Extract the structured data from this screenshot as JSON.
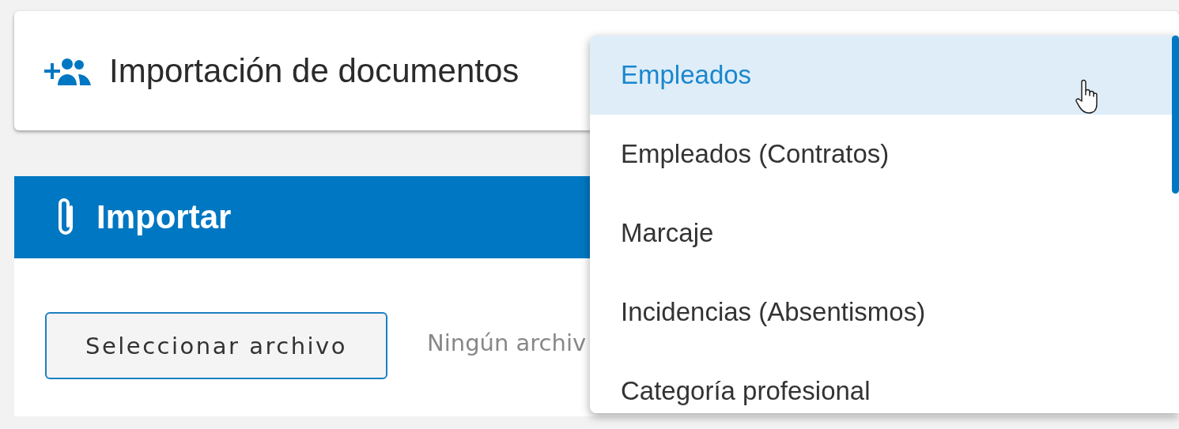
{
  "header": {
    "title": "Importación de documentos"
  },
  "import_panel": {
    "title": "Importar",
    "file_button": "Seleccionar archivo",
    "file_status": "Ningún archiv"
  },
  "dropdown": {
    "items": [
      {
        "label": "Empleados",
        "selected": true
      },
      {
        "label": "Empleados (Contratos)",
        "selected": false
      },
      {
        "label": "Marcaje",
        "selected": false
      },
      {
        "label": "Incidencias (Absentismos)",
        "selected": false
      },
      {
        "label": "Categoría profesional",
        "selected": false
      }
    ]
  }
}
